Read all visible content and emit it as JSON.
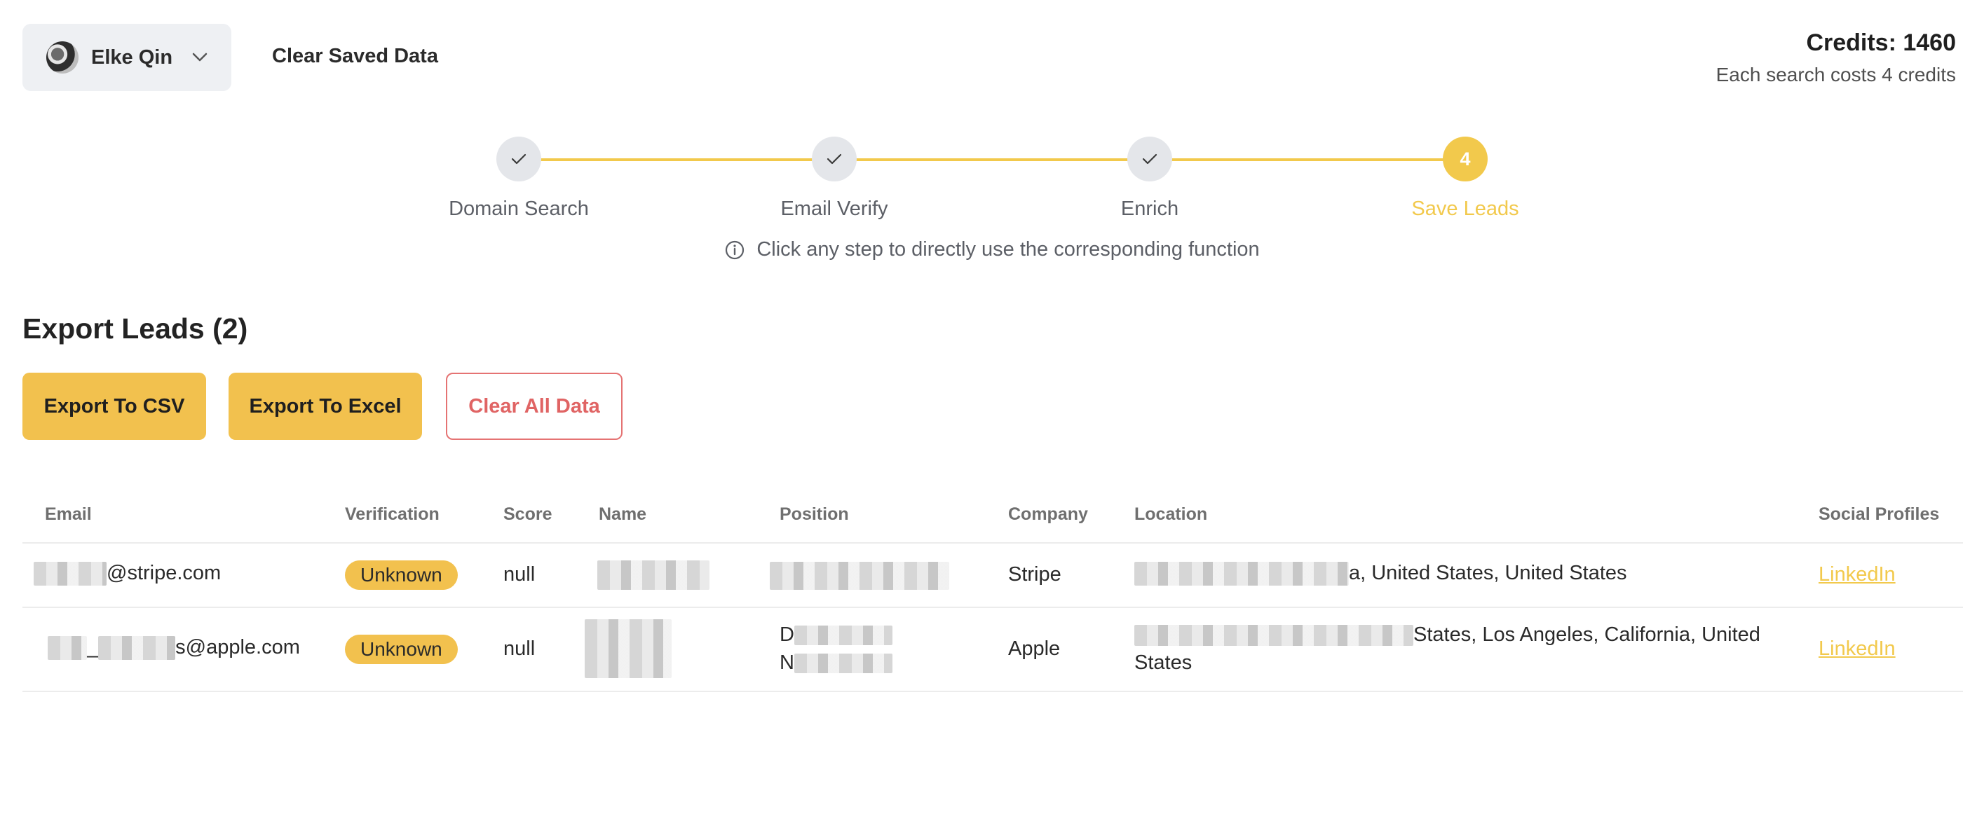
{
  "header": {
    "user_name": "Elke Qin",
    "clear_saved_label": "Clear Saved Data",
    "credits_label": "Credits: 1460",
    "credits_note": "Each search costs 4 credits"
  },
  "stepper": {
    "steps": [
      {
        "label": "Domain Search",
        "state": "done"
      },
      {
        "label": "Email Verify",
        "state": "done"
      },
      {
        "label": "Enrich",
        "state": "done"
      },
      {
        "label": "Save Leads",
        "state": "active",
        "number": "4"
      }
    ],
    "hint": "Click any step to directly use the corresponding function"
  },
  "section": {
    "title": "Export Leads (2)",
    "buttons": {
      "export_csv": "Export To CSV",
      "export_excel": "Export To Excel",
      "clear_all": "Clear All Data"
    }
  },
  "table": {
    "columns": [
      "Email",
      "Verification",
      "Score",
      "Name",
      "Position",
      "Company",
      "Location",
      "Social Profiles"
    ],
    "rows": [
      {
        "email_visible": "@stripe.com",
        "verification": "Unknown",
        "score": "null",
        "company": "Stripe",
        "location_visible": "a, United States, United States",
        "social": "LinkedIn"
      },
      {
        "email_visible_mid": "_",
        "email_visible_end": "s@apple.com",
        "verification": "Unknown",
        "score": "null",
        "position_visible_1": "D",
        "position_visible_2": "N",
        "company": "Apple",
        "location_visible": "States, Los Angeles, California, United States",
        "social": "LinkedIn"
      }
    ]
  },
  "colors": {
    "accent": "#f2c94c",
    "button_primary": "#f2c14e",
    "danger": "#e06464",
    "muted_text": "#5c5f66"
  },
  "icons": {
    "user_avatar": "avatar",
    "dropdown": "chevron-down-icon",
    "step_done": "check-icon",
    "hint": "info-icon"
  }
}
